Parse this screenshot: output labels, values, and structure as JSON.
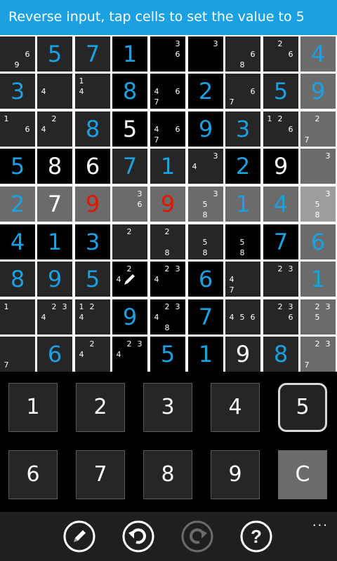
{
  "banner": {
    "text": "Reverse input, tap cells to set the value to 5"
  },
  "board": {
    "cells": [
      [
        {
          "bg": "dark",
          "cands": [
            "",
            "",
            "",
            "",
            "",
            "6",
            "",
            "9",
            ""
          ]
        },
        {
          "bg": "dark",
          "value": "5",
          "color": "blue"
        },
        {
          "bg": "dark",
          "value": "7",
          "color": "blue"
        },
        {
          "bg": "black",
          "value": "1",
          "color": "blue"
        },
        {
          "bg": "black",
          "cands": [
            "",
            "",
            "3",
            "",
            "",
            "6",
            "",
            "",
            ""
          ]
        },
        {
          "bg": "black",
          "cands": [
            "",
            "",
            "3",
            "",
            "",
            "",
            "",
            "",
            ""
          ]
        },
        {
          "bg": "dark",
          "cands": [
            "",
            "",
            "",
            "",
            "",
            "6",
            "",
            "8",
            ""
          ]
        },
        {
          "bg": "dark",
          "cands": [
            "",
            "2",
            "",
            "",
            "",
            "6",
            "",
            "",
            ""
          ]
        },
        {
          "bg": "grey",
          "value": "4",
          "color": "blue"
        }
      ],
      [
        {
          "bg": "dark",
          "value": "3",
          "color": "blue"
        },
        {
          "bg": "dark",
          "cands": [
            "",
            "",
            "",
            "4",
            "",
            "",
            "",
            "",
            ""
          ]
        },
        {
          "bg": "dark",
          "cands": [
            "1",
            "",
            "",
            "4",
            "",
            "",
            "",
            "",
            ""
          ]
        },
        {
          "bg": "black",
          "value": "8",
          "color": "blue"
        },
        {
          "bg": "black",
          "cands": [
            "",
            "",
            "",
            "4",
            "",
            "6",
            "7",
            "",
            ""
          ]
        },
        {
          "bg": "black",
          "value": "2",
          "color": "blue"
        },
        {
          "bg": "dark",
          "cands": [
            "",
            "",
            "",
            "",
            "",
            "6",
            "7",
            "",
            ""
          ]
        },
        {
          "bg": "dark",
          "value": "5",
          "color": "blue"
        },
        {
          "bg": "grey",
          "value": "9",
          "color": "blue"
        }
      ],
      [
        {
          "bg": "dark",
          "cands": [
            "1",
            "",
            "",
            "",
            "",
            "6",
            "",
            "",
            ""
          ]
        },
        {
          "bg": "dark",
          "cands": [
            "",
            "2",
            "",
            "4",
            "",
            "",
            "",
            "",
            ""
          ]
        },
        {
          "bg": "dark",
          "value": "8",
          "color": "blue"
        },
        {
          "bg": "black",
          "value": "5",
          "color": "white"
        },
        {
          "bg": "black",
          "cands": [
            "",
            "",
            "",
            "4",
            "",
            "6",
            "7",
            "",
            ""
          ]
        },
        {
          "bg": "black",
          "value": "9",
          "color": "blue"
        },
        {
          "bg": "dark",
          "value": "3",
          "color": "blue"
        },
        {
          "bg": "dark",
          "cands": [
            "1",
            "2",
            "",
            "",
            "",
            "6",
            "",
            "",
            ""
          ]
        },
        {
          "bg": "grey",
          "cands": [
            "",
            "2",
            "",
            "",
            "",
            "",
            "7",
            "",
            ""
          ]
        }
      ],
      [
        {
          "bg": "black",
          "value": "5",
          "color": "blue"
        },
        {
          "bg": "black",
          "value": "8",
          "color": "white"
        },
        {
          "bg": "black",
          "value": "6",
          "color": "white"
        },
        {
          "bg": "dark",
          "value": "7",
          "color": "blue"
        },
        {
          "bg": "dark",
          "value": "1",
          "color": "blue"
        },
        {
          "bg": "dark",
          "cands": [
            "",
            "",
            "3",
            "4",
            "",
            "",
            "",
            "",
            ""
          ]
        },
        {
          "bg": "black",
          "value": "2",
          "color": "blue"
        },
        {
          "bg": "black",
          "value": "9",
          "color": "white"
        },
        {
          "bg": "grey",
          "cands": [
            "",
            "",
            "3",
            "",
            "",
            "",
            "",
            "",
            ""
          ]
        }
      ],
      [
        {
          "bg": "grey",
          "value": "2",
          "color": "blue"
        },
        {
          "bg": "grey",
          "value": "7",
          "color": "white"
        },
        {
          "bg": "grey",
          "value": "9",
          "color": "red"
        },
        {
          "bg": "grey",
          "cands": [
            "",
            "",
            "3",
            "",
            "",
            "6",
            "",
            "",
            ""
          ]
        },
        {
          "bg": "grey",
          "value": "9",
          "color": "red"
        },
        {
          "bg": "grey",
          "cands": [
            "",
            "",
            "3",
            "",
            "5",
            "",
            "",
            "8",
            ""
          ]
        },
        {
          "bg": "grey",
          "value": "1",
          "color": "blue"
        },
        {
          "bg": "grey",
          "value": "4",
          "color": "blue"
        },
        {
          "bg": "light",
          "cands": [
            "",
            "",
            "3",
            "",
            "5",
            "",
            "",
            "8",
            ""
          ]
        }
      ],
      [
        {
          "bg": "black",
          "value": "4",
          "color": "blue"
        },
        {
          "bg": "black",
          "value": "1",
          "color": "blue"
        },
        {
          "bg": "black",
          "value": "3",
          "color": "blue"
        },
        {
          "bg": "dark",
          "cands": [
            "",
            "2",
            "",
            "",
            "",
            "",
            "",
            "",
            ""
          ]
        },
        {
          "bg": "dark",
          "cands": [
            "",
            "2",
            "",
            "",
            "",
            "",
            "",
            "8",
            ""
          ]
        },
        {
          "bg": "dark",
          "cands": [
            "",
            "",
            "",
            "",
            "5",
            "",
            "",
            "8",
            ""
          ]
        },
        {
          "bg": "black",
          "cands": [
            "",
            "",
            "",
            "",
            "5",
            "",
            "",
            "8",
            ""
          ]
        },
        {
          "bg": "black",
          "value": "7",
          "color": "blue"
        },
        {
          "bg": "grey",
          "value": "6",
          "color": "blue"
        }
      ],
      [
        {
          "bg": "dark",
          "value": "8",
          "color": "blue"
        },
        {
          "bg": "dark",
          "value": "9",
          "color": "blue"
        },
        {
          "bg": "dark",
          "value": "5",
          "color": "blue"
        },
        {
          "bg": "black",
          "cands": [
            "",
            "2",
            "",
            "4",
            "",
            "",
            "",
            "",
            ""
          ],
          "pencil": true
        },
        {
          "bg": "black",
          "cands": [
            "",
            "2",
            "3",
            "4",
            "",
            "",
            "",
            "",
            ""
          ]
        },
        {
          "bg": "black",
          "value": "6",
          "color": "blue"
        },
        {
          "bg": "dark",
          "cands": [
            "",
            "",
            "",
            "4",
            "",
            "",
            "7",
            "",
            ""
          ]
        },
        {
          "bg": "dark",
          "cands": [
            "",
            "2",
            "3",
            "",
            "",
            "",
            "",
            "",
            ""
          ]
        },
        {
          "bg": "grey",
          "value": "1",
          "color": "blue"
        }
      ],
      [
        {
          "bg": "dark",
          "cands": [
            "1",
            "",
            "",
            "",
            "",
            "",
            "",
            "",
            ""
          ]
        },
        {
          "bg": "dark",
          "cands": [
            "",
            "2",
            "3",
            "4",
            "",
            "",
            "",
            "",
            ""
          ]
        },
        {
          "bg": "dark",
          "cands": [
            "1",
            "2",
            "",
            "4",
            "",
            "",
            "",
            "",
            ""
          ]
        },
        {
          "bg": "black",
          "value": "9",
          "color": "blue"
        },
        {
          "bg": "black",
          "cands": [
            "",
            "2",
            "3",
            "4",
            "",
            "",
            "",
            "8",
            ""
          ]
        },
        {
          "bg": "black",
          "value": "7",
          "color": "blue"
        },
        {
          "bg": "dark",
          "cands": [
            "",
            "",
            "",
            "4",
            "5",
            "6",
            "",
            "",
            ""
          ]
        },
        {
          "bg": "dark",
          "cands": [
            "",
            "2",
            "3",
            "",
            "",
            "6",
            "",
            "",
            ""
          ]
        },
        {
          "bg": "grey",
          "cands": [
            "",
            "2",
            "3",
            "",
            "5",
            "",
            "",
            "",
            ""
          ]
        }
      ],
      [
        {
          "bg": "dark",
          "cands": [
            "",
            "",
            "",
            "",
            "",
            "",
            "7",
            "",
            ""
          ]
        },
        {
          "bg": "dark",
          "value": "6",
          "color": "blue"
        },
        {
          "bg": "dark",
          "cands": [
            "",
            "2",
            "",
            "4",
            "",
            "",
            "",
            "",
            ""
          ]
        },
        {
          "bg": "black",
          "cands": [
            "",
            "2",
            "3",
            "4",
            "",
            "",
            "",
            "",
            ""
          ]
        },
        {
          "bg": "black",
          "value": "5",
          "color": "blue"
        },
        {
          "bg": "black",
          "value": "1",
          "color": "blue"
        },
        {
          "bg": "dark",
          "value": "9",
          "color": "white"
        },
        {
          "bg": "dark",
          "value": "8",
          "color": "blue"
        },
        {
          "bg": "grey",
          "cands": [
            "",
            "2",
            "3",
            "",
            "",
            "",
            "7",
            "",
            ""
          ]
        }
      ]
    ]
  },
  "keypad": {
    "keys": [
      "1",
      "2",
      "3",
      "4",
      "5",
      "6",
      "7",
      "8",
      "9",
      "C"
    ],
    "selected": "5"
  },
  "appbar": {
    "buttons": [
      {
        "name": "pencil-mode-button",
        "icon": "pencil-icon"
      },
      {
        "name": "undo-button",
        "icon": "undo-icon"
      },
      {
        "name": "redo-button",
        "icon": "redo-icon",
        "disabled": true
      },
      {
        "name": "help-button",
        "icon": "help-icon"
      }
    ],
    "more": "..."
  },
  "colors": {
    "accent": "#1ba1e2",
    "conflict": "#e51400",
    "given": "#ffffff"
  }
}
